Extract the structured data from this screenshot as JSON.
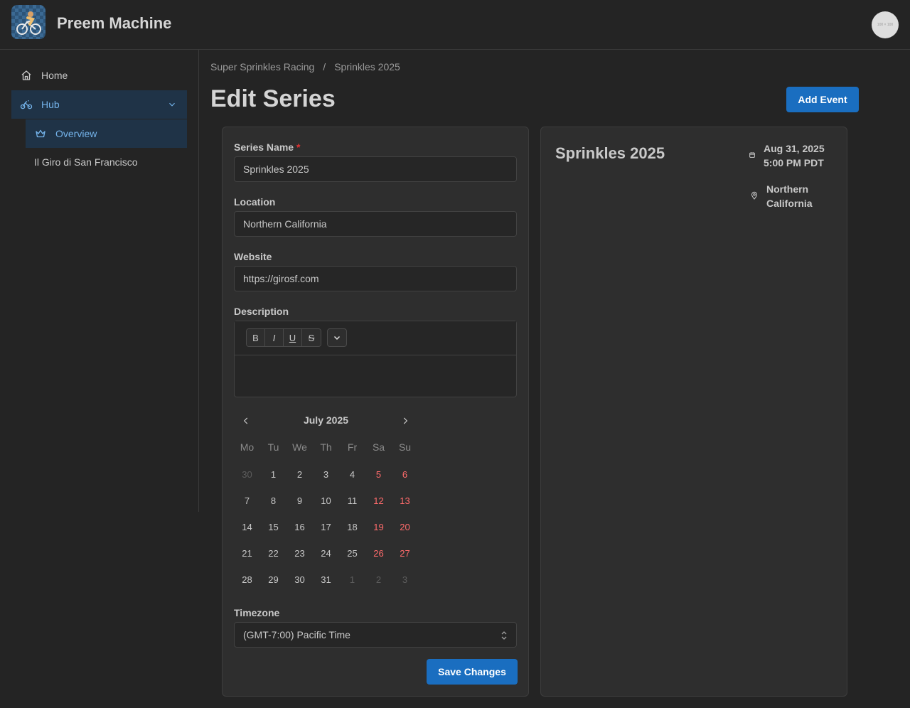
{
  "app": {
    "title": "Preem Machine",
    "avatar_text": "100 × 100"
  },
  "sidebar": {
    "items": [
      {
        "label": "Home",
        "icon": "home-icon"
      },
      {
        "label": "Hub",
        "icon": "bike-icon"
      },
      {
        "label": "Overview",
        "icon": "crown-icon"
      },
      {
        "label": "Il Giro di San Francisco"
      }
    ]
  },
  "breadcrumb": {
    "items": [
      "Super Sprinkles Racing",
      "Sprinkles 2025"
    ],
    "separator": "/"
  },
  "page": {
    "title": "Edit Series",
    "add_event_label": "Add Event"
  },
  "form": {
    "series_name": {
      "label": "Series Name",
      "required_mark": "*",
      "value": "Sprinkles 2025"
    },
    "location": {
      "label": "Location",
      "value": "Northern California"
    },
    "website": {
      "label": "Website",
      "value": "https://girosf.com"
    },
    "description": {
      "label": "Description",
      "toolbar": [
        "B",
        "I",
        "U",
        "S"
      ]
    },
    "timezone": {
      "label": "Timezone",
      "value": "(GMT-7:00) Pacific Time"
    },
    "save_label": "Save Changes"
  },
  "calendar": {
    "month": "July 2025",
    "weekdays": [
      "Mo",
      "Tu",
      "We",
      "Th",
      "Fr",
      "Sa",
      "Su"
    ],
    "weeks": [
      [
        "30",
        "1",
        "2",
        "3",
        "4",
        "5",
        "6"
      ],
      [
        "7",
        "8",
        "9",
        "10",
        "11",
        "12",
        "13"
      ],
      [
        "14",
        "15",
        "16",
        "17",
        "18",
        "19",
        "20"
      ],
      [
        "21",
        "22",
        "23",
        "24",
        "25",
        "26",
        "27"
      ],
      [
        "28",
        "29",
        "30",
        "31",
        "1",
        "2",
        "3"
      ]
    ]
  },
  "preview": {
    "title": "Sprinkles 2025",
    "date": "Aug 31, 2025",
    "time": "5:00 PM PDT",
    "location_line1": "Northern",
    "location_line2": "California"
  },
  "colors": {
    "accent": "#1a6ec0",
    "nav_active_bg": "#1f3347",
    "nav_active_text": "#74b3ea",
    "weekend": "#ff6b6b",
    "required": "#e03131"
  }
}
